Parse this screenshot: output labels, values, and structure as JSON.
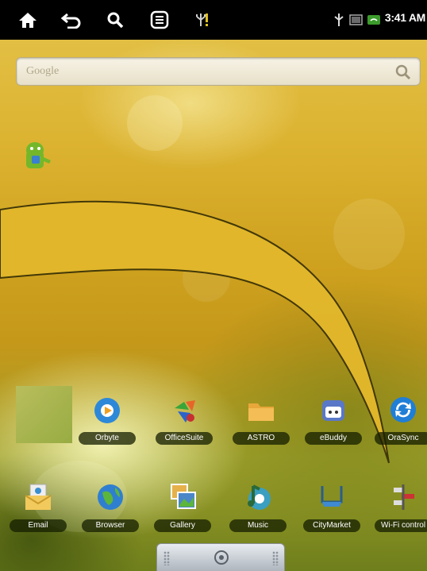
{
  "status_bar": {
    "time": "3:41 AM",
    "icons": [
      "home-icon",
      "back-icon",
      "search-icon",
      "menu-icon",
      "usb-icon",
      "notification-icon",
      "usb-status-icon",
      "battery-icon",
      "wifi-icon"
    ]
  },
  "search": {
    "placeholder": "Google"
  },
  "apps_row1": [
    {
      "label": "Orbyte",
      "icon": "orbyte-icon"
    },
    {
      "label": "OfficeSuite",
      "icon": "officesuite-icon"
    },
    {
      "label": "ASTRO",
      "icon": "astro-folder-icon"
    },
    {
      "label": "eBuddy",
      "icon": "ebuddy-icon"
    },
    {
      "label": "OraSync",
      "icon": "sync-icon"
    }
  ],
  "apps_row2": [
    {
      "label": "Email",
      "icon": "email-icon"
    },
    {
      "label": "Browser",
      "icon": "browser-icon"
    },
    {
      "label": "Gallery",
      "icon": "gallery-icon"
    },
    {
      "label": "Music",
      "icon": "music-icon"
    },
    {
      "label": "CityMarket",
      "icon": "market-icon"
    },
    {
      "label": "Wi-Fi control",
      "icon": "wifi-control-icon"
    }
  ],
  "colors": {
    "wallpaper": "#d7ac2c",
    "arrow_fill": "#e0b62b",
    "status_bar": "#000000"
  }
}
